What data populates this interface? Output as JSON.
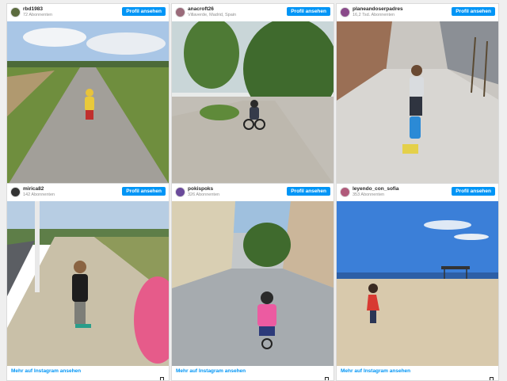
{
  "posts": [
    {
      "username": "rbd1983",
      "subline": "72 Abonnenten",
      "button": "Profil ansehen",
      "avatar_color": "#5b6b3e"
    },
    {
      "username": "anacroft26",
      "subline": "Villaverde, Madrid, Spain",
      "button": "Profil ansehen",
      "avatar_color": "#9a6b7a"
    },
    {
      "username": "planeandoserpadres",
      "subline": "16,2 Tsd. Abonnenten",
      "button": "Profil ansehen",
      "avatar_color": "#8a4a8a"
    },
    {
      "username": "mirica82",
      "subline": "142 Abonnenten",
      "button": "Profil ansehen",
      "avatar_color": "#333333",
      "link": "Mehr auf Instagram ansehen"
    },
    {
      "username": "pokispoks",
      "subline": "326 Abonnenten",
      "button": "Profil ansehen",
      "avatar_color": "#6a4a9a",
      "link": "Mehr auf Instagram ansehen"
    },
    {
      "username": "leyendo_con_sofia",
      "subline": "353 Abonnenten",
      "button": "Profil ansehen",
      "avatar_color": "#b05a7a",
      "link": "Mehr auf Instagram ansehen"
    }
  ],
  "colors": {
    "button": "#0095f6",
    "link": "#0095f6"
  }
}
